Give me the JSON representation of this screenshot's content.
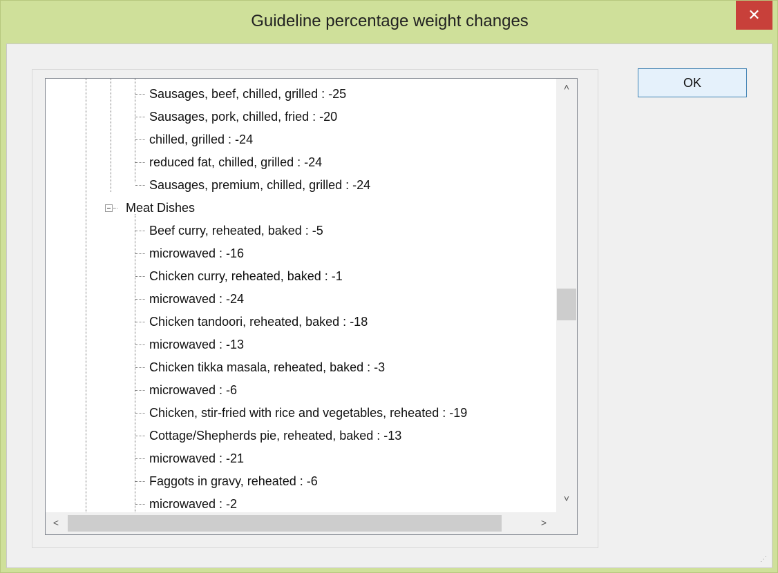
{
  "window": {
    "title": "Guideline percentage weight changes",
    "close_glyph": "✕"
  },
  "buttons": {
    "ok_label": "OK"
  },
  "tree": {
    "items": [
      {
        "label": "Sausages, beef, chilled, grilled : -25",
        "level": 2
      },
      {
        "label": "Sausages, pork, chilled, fried : -20",
        "level": 2
      },
      {
        "label": "chilled, grilled : -24",
        "level": 2
      },
      {
        "label": "reduced fat, chilled, grilled : -24",
        "level": 2
      },
      {
        "label": "Sausages, premium, chilled, grilled : -24",
        "level": 2
      },
      {
        "label": "Meat Dishes",
        "level": 1,
        "expanded": true
      },
      {
        "label": "Beef curry, reheated, baked : -5",
        "level": 2
      },
      {
        "label": "microwaved : -16",
        "level": 2
      },
      {
        "label": "Chicken curry, reheated, baked : -1",
        "level": 2
      },
      {
        "label": "microwaved : -24",
        "level": 2
      },
      {
        "label": "Chicken tandoori, reheated, baked : -18",
        "level": 2
      },
      {
        "label": "microwaved : -13",
        "level": 2
      },
      {
        "label": "Chicken tikka masala, reheated, baked : -3",
        "level": 2
      },
      {
        "label": "microwaved : -6",
        "level": 2
      },
      {
        "label": "Chicken, stir-fried with rice and vegetables, reheated : -19",
        "level": 2
      },
      {
        "label": "Cottage/Shepherds pie, reheated, baked : -13",
        "level": 2
      },
      {
        "label": "microwaved : -21",
        "level": 2
      },
      {
        "label": "Faggots in gravy, reheated : -6",
        "level": 2
      },
      {
        "label": "microwaved : -2",
        "level": 2
      }
    ]
  },
  "scrollbars": {
    "up_arrow": "˄",
    "down_arrow": "˅",
    "left_arrow": "<",
    "right_arrow": ">",
    "vertical_position": 0.48
  },
  "icons": {
    "close": "close-icon",
    "expander": "minus-expander-icon",
    "grip": "resize-grip-icon"
  }
}
